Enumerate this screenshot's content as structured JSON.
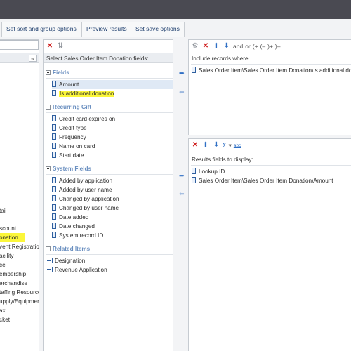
{
  "tabs": [
    {
      "label": "Set sort and group options"
    },
    {
      "label": "Preview results"
    },
    {
      "label": "Set save options"
    }
  ],
  "left_panel": {
    "collapse_glyph": "«",
    "items": [
      "tail",
      "scount",
      "onation",
      "vent Registration",
      "acility",
      "ce",
      "embership",
      "erchandise",
      "taffing Resource",
      "upply/Equipment",
      "ax",
      "cket"
    ],
    "highlighted_item": "onation"
  },
  "fields_panel": {
    "header": "Select Sales Order Item Donation fields:",
    "groups": [
      {
        "title": "Fields",
        "items": [
          "Amount",
          "Is additional donation"
        ]
      },
      {
        "title": "Recurring Gift",
        "items": [
          "Credit card expires on",
          "Credit type",
          "Frequency",
          "Name on card",
          "Start date"
        ]
      },
      {
        "title": "System Fields",
        "items": [
          "Added by application",
          "Added by user name",
          "Changed by application",
          "Changed by user name",
          "Date added",
          "Date changed",
          "System record ID"
        ]
      },
      {
        "title": "Related Items",
        "items": [
          "Designation",
          "Revenue Application"
        ]
      }
    ],
    "selected_item": "Amount",
    "highlighted_item": "Is additional donation"
  },
  "filter_panel": {
    "toolbar": {
      "and_label": "and",
      "or_label": "or",
      "open_paren": "(+",
      "close_paren_a": "(–",
      "close_paren_b": ")+",
      "close_paren_c": ")–"
    },
    "header": "Include records where:",
    "rows": [
      "Sales Order Item\\Sales Order Item Donation\\Is additional do"
    ]
  },
  "output_panel": {
    "toolbar": {
      "sigma": "Σ",
      "dropdown": "▾",
      "spell": "abc"
    },
    "header": "Results fields to display:",
    "rows": [
      "Lookup ID",
      "Sales Order Item\\Sales Order Item Donation\\Amount"
    ]
  },
  "colors": {
    "highlight": "#fbf63a",
    "link": "#1f3f6e",
    "group_header": "#6a8fc0",
    "delete": "#d02020",
    "arrow": "#2f6fc4"
  },
  "icons": [
    "filter-icon",
    "delete-icon",
    "move-up-icon",
    "move-down-icon",
    "add-field-icon",
    "remove-field-icon",
    "sum-icon",
    "spellcheck-icon",
    "collapse-icon"
  ]
}
